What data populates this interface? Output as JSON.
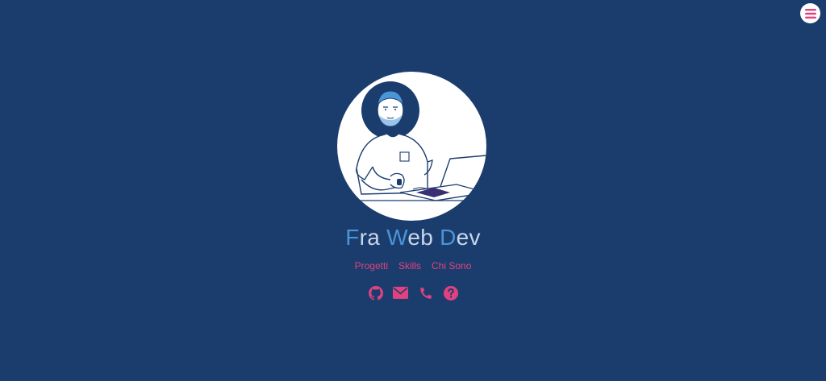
{
  "header": {
    "menu_icon": "hamburger-icon"
  },
  "hero": {
    "avatar_alt": "illustration of developer at laptop",
    "brand": {
      "parts": [
        {
          "initial": "F",
          "rest": "ra"
        },
        {
          "initial": "W",
          "rest": "eb"
        },
        {
          "initial": "D",
          "rest": "ev"
        }
      ]
    },
    "nav": [
      {
        "label": "Progetti"
      },
      {
        "label": "Skills"
      },
      {
        "label": "Chi Sono"
      }
    ],
    "social_icons": [
      "github-icon",
      "envelope-icon",
      "phone-icon",
      "question-circle-icon"
    ]
  },
  "colors": {
    "background": "#1b3d6e",
    "accent_pink": "#e0417f",
    "brand_text": "#c7d6ea",
    "brand_initial": "#4a94d8"
  }
}
